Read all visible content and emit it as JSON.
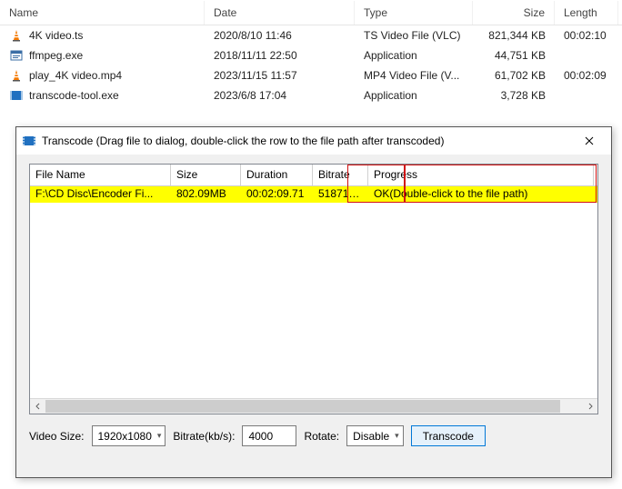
{
  "fileList": {
    "headers": {
      "name": "Name",
      "date": "Date",
      "type": "Type",
      "size": "Size",
      "length": "Length"
    },
    "rows": [
      {
        "icon": "vlc-cone",
        "name": "4K video.ts",
        "date": "2020/8/10 11:46",
        "type": "TS Video File (VLC)",
        "size": "821,344 KB",
        "length": "00:02:10"
      },
      {
        "icon": "exe",
        "name": "ffmpeg.exe",
        "date": "2018/11/11 22:50",
        "type": "Application",
        "size": "44,751 KB",
        "length": ""
      },
      {
        "icon": "vlc-cone",
        "name": "play_4K video.mp4",
        "date": "2023/11/15 11:57",
        "type": "MP4 Video File (V...",
        "size": "61,702 KB",
        "length": "00:02:09"
      },
      {
        "icon": "film",
        "name": "transcode-tool.exe",
        "date": "2023/6/8 17:04",
        "type": "Application",
        "size": "3,728 KB",
        "length": ""
      }
    ]
  },
  "dialog": {
    "title": "Transcode (Drag file to dialog, double-click the row to the file path after transcoded)",
    "grid": {
      "headers": {
        "fn": "File Name",
        "sz": "Size",
        "du": "Duration",
        "br": "Bitrate",
        "pr": "Progress"
      },
      "row": {
        "fn": "F:\\CD Disc\\Encoder Fi...",
        "sz": "802.09MB",
        "du": "00:02:09.71",
        "br": "51871 k...",
        "pr": "OK(Double-click to the file path)"
      }
    },
    "controls": {
      "videoSizeLabel": "Video Size:",
      "videoSizeValue": "1920x1080",
      "bitrateLabel": "Bitrate(kb/s):",
      "bitrateValue": "4000",
      "rotateLabel": "Rotate:",
      "rotateValue": "Disable",
      "transcodeLabel": "Transcode"
    }
  }
}
